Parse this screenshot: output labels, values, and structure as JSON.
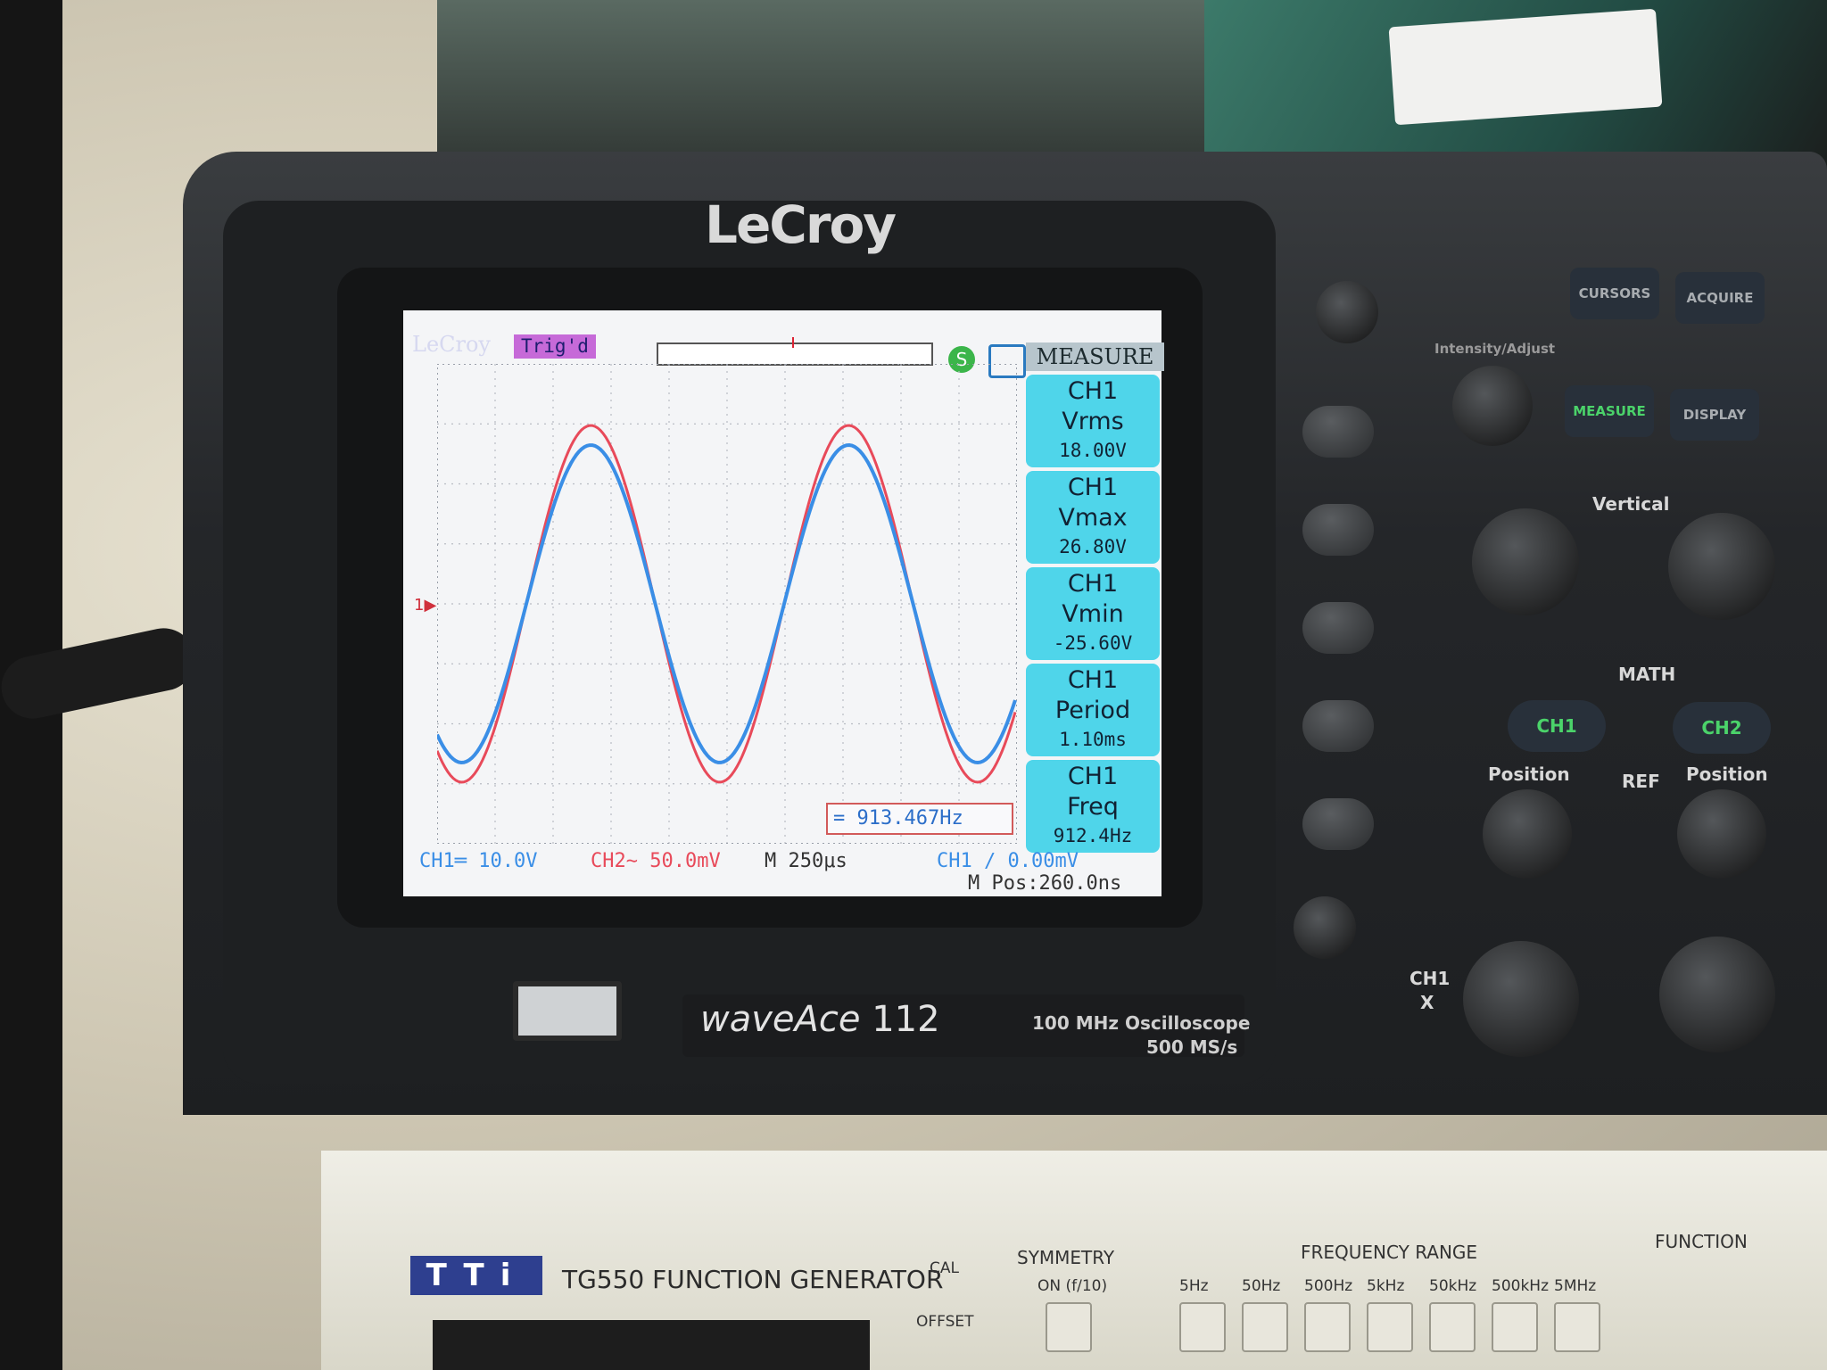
{
  "scope": {
    "brand": "LeCroy",
    "model_prefix": "waveAce",
    "model_number": "112",
    "spec_bandwidth": "100 MHz Oscilloscope",
    "spec_sample_rate": "500 MS/s"
  },
  "screen": {
    "brand_watermark": "LeCroy",
    "trigger_status": "Trig'd",
    "menu_title": "MEASURE",
    "measurements": [
      {
        "channel": "CH1",
        "name": "Vrms",
        "value": "18.00V"
      },
      {
        "channel": "CH1",
        "name": "Vmax",
        "value": "26.80V"
      },
      {
        "channel": "CH1",
        "name": "Vmin",
        "value": "-25.60V"
      },
      {
        "channel": "CH1",
        "name": "Period",
        "value": "1.10ms"
      },
      {
        "channel": "CH1",
        "name": "Freq",
        "value": "912.4Hz"
      }
    ],
    "freq_counter": "= 913.467Hz",
    "ch1_scale": "CH1═ 10.0V",
    "ch2_scale": "CH2∼ 50.0mV",
    "timebase": "M 250μs",
    "trigger_setting": "CH1 ∕ 0.00mV",
    "m_pos": "M Pos:260.0ns",
    "colors": {
      "ch1": "#3a8ee6",
      "ch2": "#e84a5a",
      "panel": "#4fd5ea"
    }
  },
  "front_panel": {
    "buttons": [
      "CURSORS",
      "ACQUIRE",
      "MEASURE",
      "DISPLAY"
    ],
    "intensity_label": "Intensity/Adjust",
    "vertical_label": "Vertical",
    "math_label": "MATH",
    "ch1_button": "CH1",
    "ch2_button": "CH2",
    "position_left": "Position",
    "ref_label": "REF",
    "position_right": "Position",
    "ch1_input": "CH1",
    "ch1_input_sub": "X"
  },
  "generator": {
    "brand": "TTi",
    "title": "TG550 FUNCTION GENERATOR",
    "cal_label": "CAL",
    "offset_label": "OFFSET",
    "symmetry_label": "SYMMETRY",
    "symmetry_sub": "ON (f/10)",
    "range_label": "FREQUENCY RANGE",
    "ranges": [
      "5Hz",
      "50Hz",
      "500Hz",
      "5kHz",
      "50kHz",
      "500kHz",
      "5MHz"
    ],
    "function_label": "FUNCTION"
  }
}
